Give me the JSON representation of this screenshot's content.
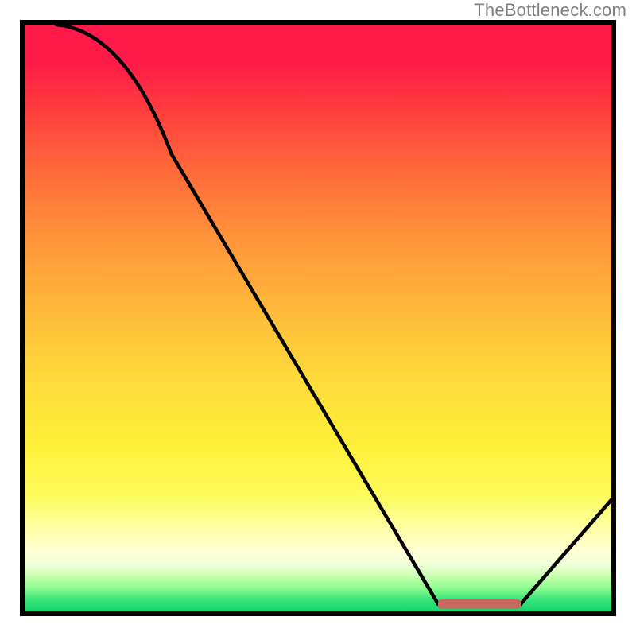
{
  "watermark": "TheBottleneck.com",
  "marker": {
    "color": "#c96a62",
    "x_start_pct": 70.5,
    "x_end_pct": 84.5,
    "y_pct": 98.8
  },
  "chart_data": {
    "type": "line",
    "title": "",
    "xlabel": "",
    "ylabel": "",
    "xlim": [
      0,
      100
    ],
    "ylim": [
      0,
      100
    ],
    "x": [
      5.4,
      25.0,
      70.5,
      84.5,
      100.0
    ],
    "values": [
      100.0,
      78.0,
      1.2,
      1.2,
      19.0
    ],
    "annotations": [],
    "legend": [],
    "gradient_stops": [
      {
        "pct": 0,
        "color": "#ff1a49"
      },
      {
        "pct": 6,
        "color": "#ff1a49"
      },
      {
        "pct": 14,
        "color": "#ff3b3f"
      },
      {
        "pct": 25,
        "color": "#ff6a3a"
      },
      {
        "pct": 35,
        "color": "#ff8f3a"
      },
      {
        "pct": 48,
        "color": "#ffb83a"
      },
      {
        "pct": 60,
        "color": "#ffd93a"
      },
      {
        "pct": 72,
        "color": "#fff03a"
      },
      {
        "pct": 80,
        "color": "#fffb5a"
      },
      {
        "pct": 85,
        "color": "#feff9a"
      },
      {
        "pct": 90,
        "color": "#ffffd8"
      },
      {
        "pct": 92,
        "color": "#f0ffd8"
      },
      {
        "pct": 94,
        "color": "#c8ffb0"
      },
      {
        "pct": 96,
        "color": "#8ffb8f"
      },
      {
        "pct": 98,
        "color": "#38e47a"
      },
      {
        "pct": 100,
        "color": "#16d46a"
      }
    ]
  }
}
